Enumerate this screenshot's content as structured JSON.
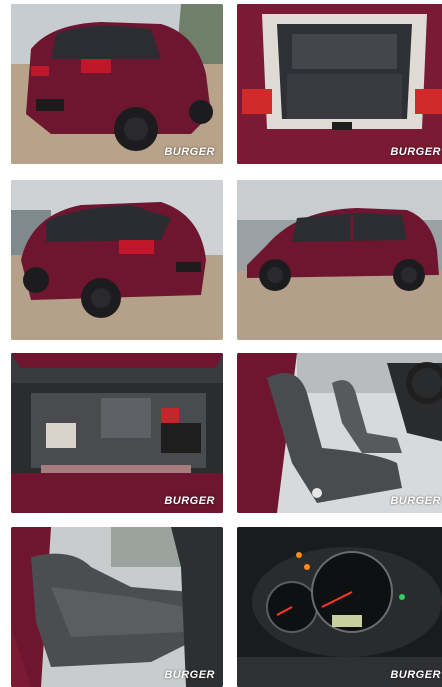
{
  "watermark": "BURGER",
  "colors": {
    "body_paint": "#6e1630",
    "accent_red": "#c0182a",
    "pavement": "#b9a58e"
  },
  "tiles": [
    {
      "id": "rear-three-quarter"
    },
    {
      "id": "open-trunk"
    },
    {
      "id": "rear-side"
    },
    {
      "id": "side-profile"
    },
    {
      "id": "engine-bay"
    },
    {
      "id": "front-seats"
    },
    {
      "id": "rear-seats"
    },
    {
      "id": "instrument-cluster"
    }
  ]
}
